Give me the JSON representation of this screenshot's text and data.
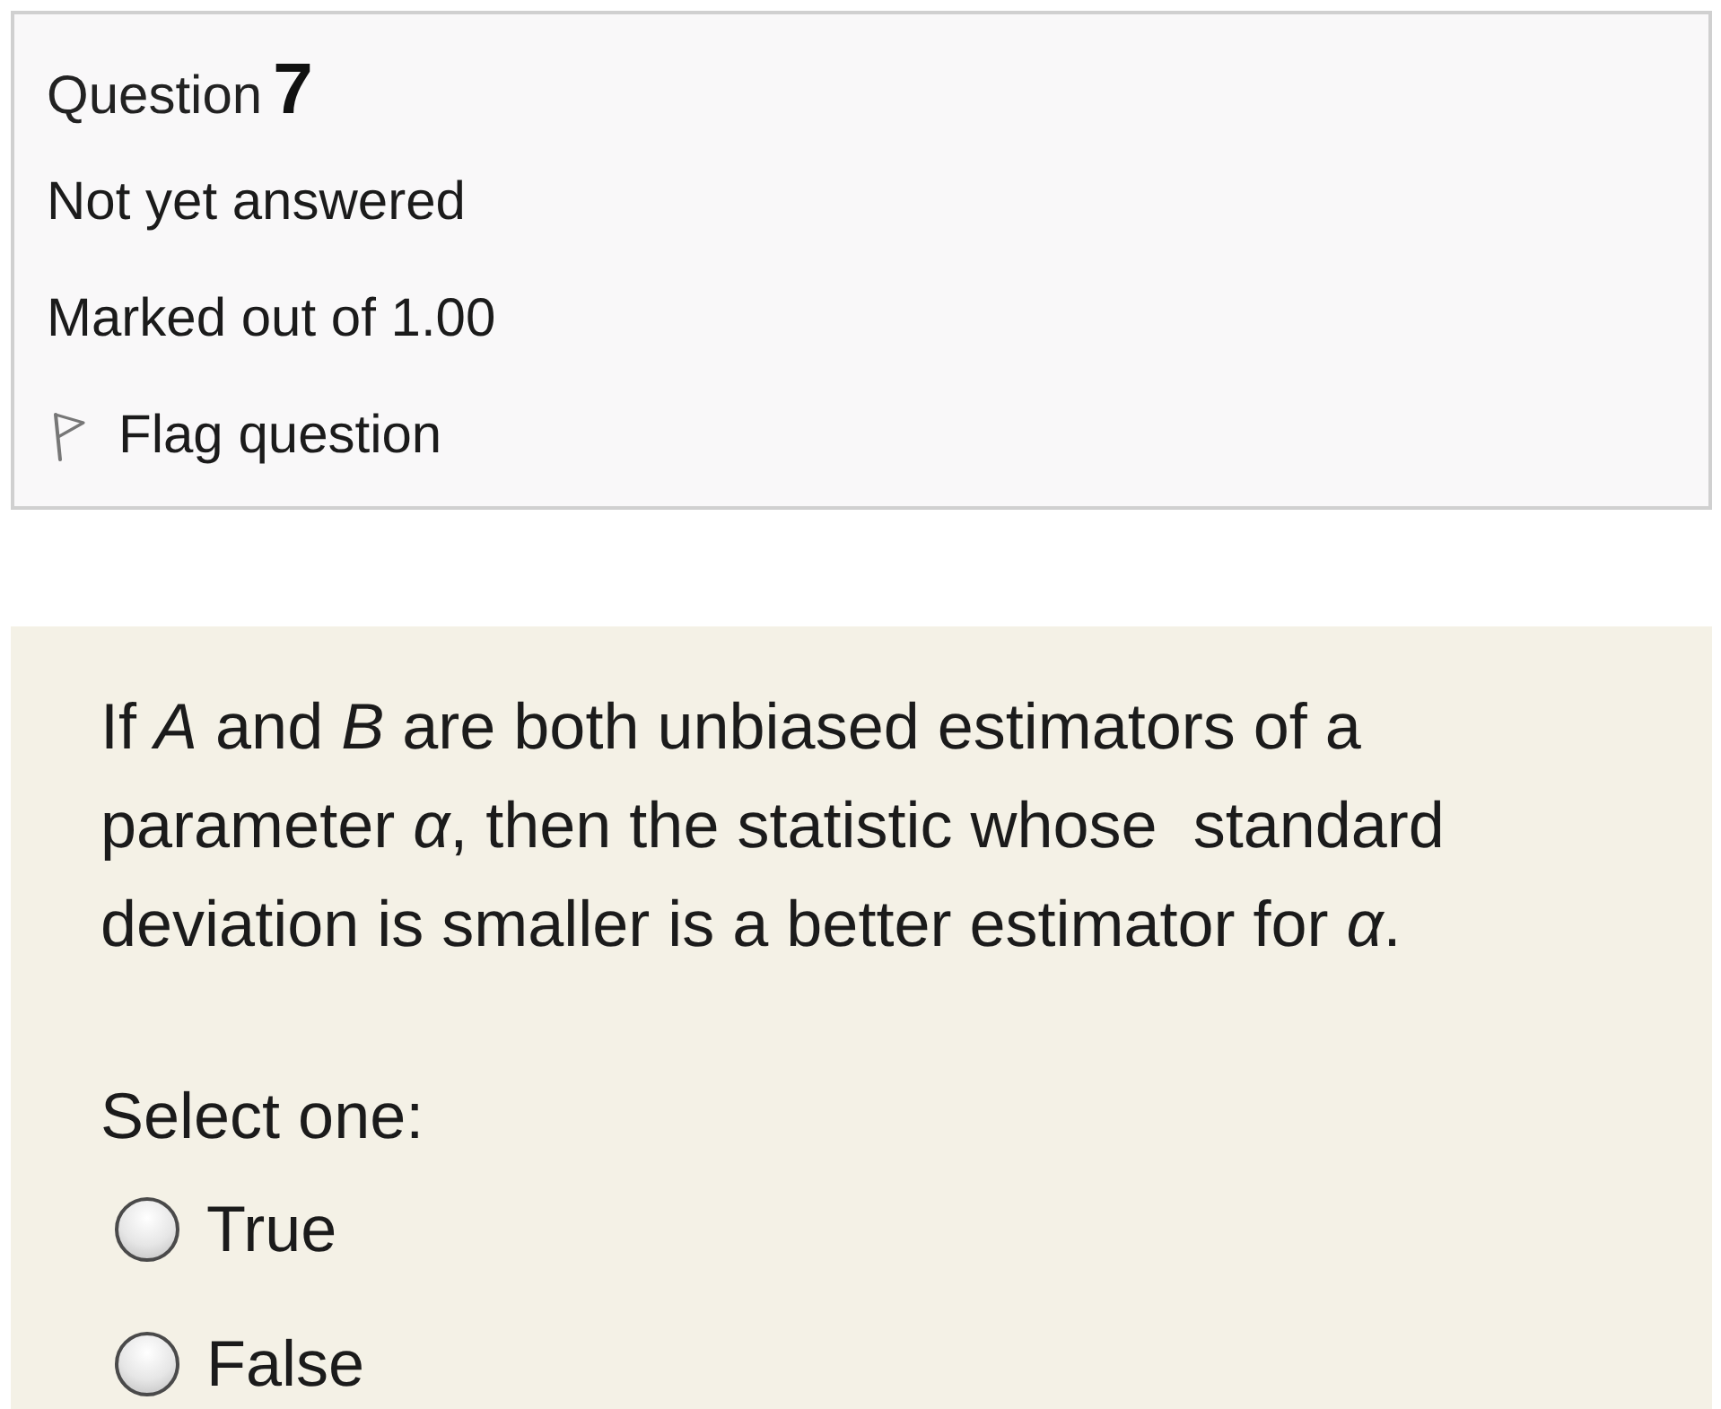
{
  "info": {
    "question_label": "Question",
    "question_number": "7",
    "status": "Not yet answered",
    "mark": "Marked out of 1.00",
    "flag": {
      "label": "Flag question",
      "flagged": false
    }
  },
  "content": {
    "question_text": "If *A* and *B* are both unbiased estimators of a parameter *α*, then the statistic whose  standard deviation is smaller is a better estimator for *α*.",
    "prompt": "Select one:",
    "options": [
      {
        "label": "True",
        "selected": false
      },
      {
        "label": "False",
        "selected": false
      }
    ]
  }
}
